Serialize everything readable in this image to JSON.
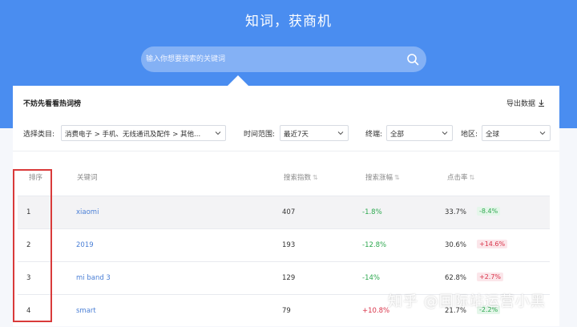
{
  "header": {
    "title": "知词，获商机",
    "search_placeholder": "输入你想要搜索的关键词"
  },
  "panel": {
    "title": "不妨先看看热词榜",
    "export_label": "导出数据"
  },
  "filters": {
    "category_label": "选择类目:",
    "category_value": "消费电子 > 手机、无线通讯及配件 > 其他...",
    "time_label": "时间范围:",
    "time_value": "最近7天",
    "channel_label": "终端:",
    "channel_value": "全部",
    "region_label": "地区:",
    "region_value": "全球"
  },
  "table": {
    "headers": [
      "排序",
      "关键词",
      "搜索指数",
      "搜索涨幅",
      "点击率"
    ],
    "rows": [
      {
        "rank": "1",
        "keyword": "xiaomi",
        "index": "407",
        "growth": "-1.8%",
        "ctr": "33.7%",
        "ctr_change": "-8.4%"
      },
      {
        "rank": "2",
        "keyword": "2019",
        "index": "193",
        "growth": "-12.8%",
        "ctr": "30.6%",
        "ctr_change": "+14.6%"
      },
      {
        "rank": "3",
        "keyword": "mi band 3",
        "index": "129",
        "growth": "-14%",
        "ctr": "62.8%",
        "ctr_change": "+2.7%"
      },
      {
        "rank": "4",
        "keyword": "smart",
        "index": "79",
        "growth": "+10.8%",
        "ctr": "21.7%",
        "ctr_change": "-2.2%"
      }
    ]
  },
  "watermark": "知乎 @国际站运营小黑",
  "colors": {
    "brand_blue": "#4a8df0",
    "positive_green": "#2da84f",
    "negative_red": "#d9344a",
    "annotation_red": "#d93a3a"
  }
}
